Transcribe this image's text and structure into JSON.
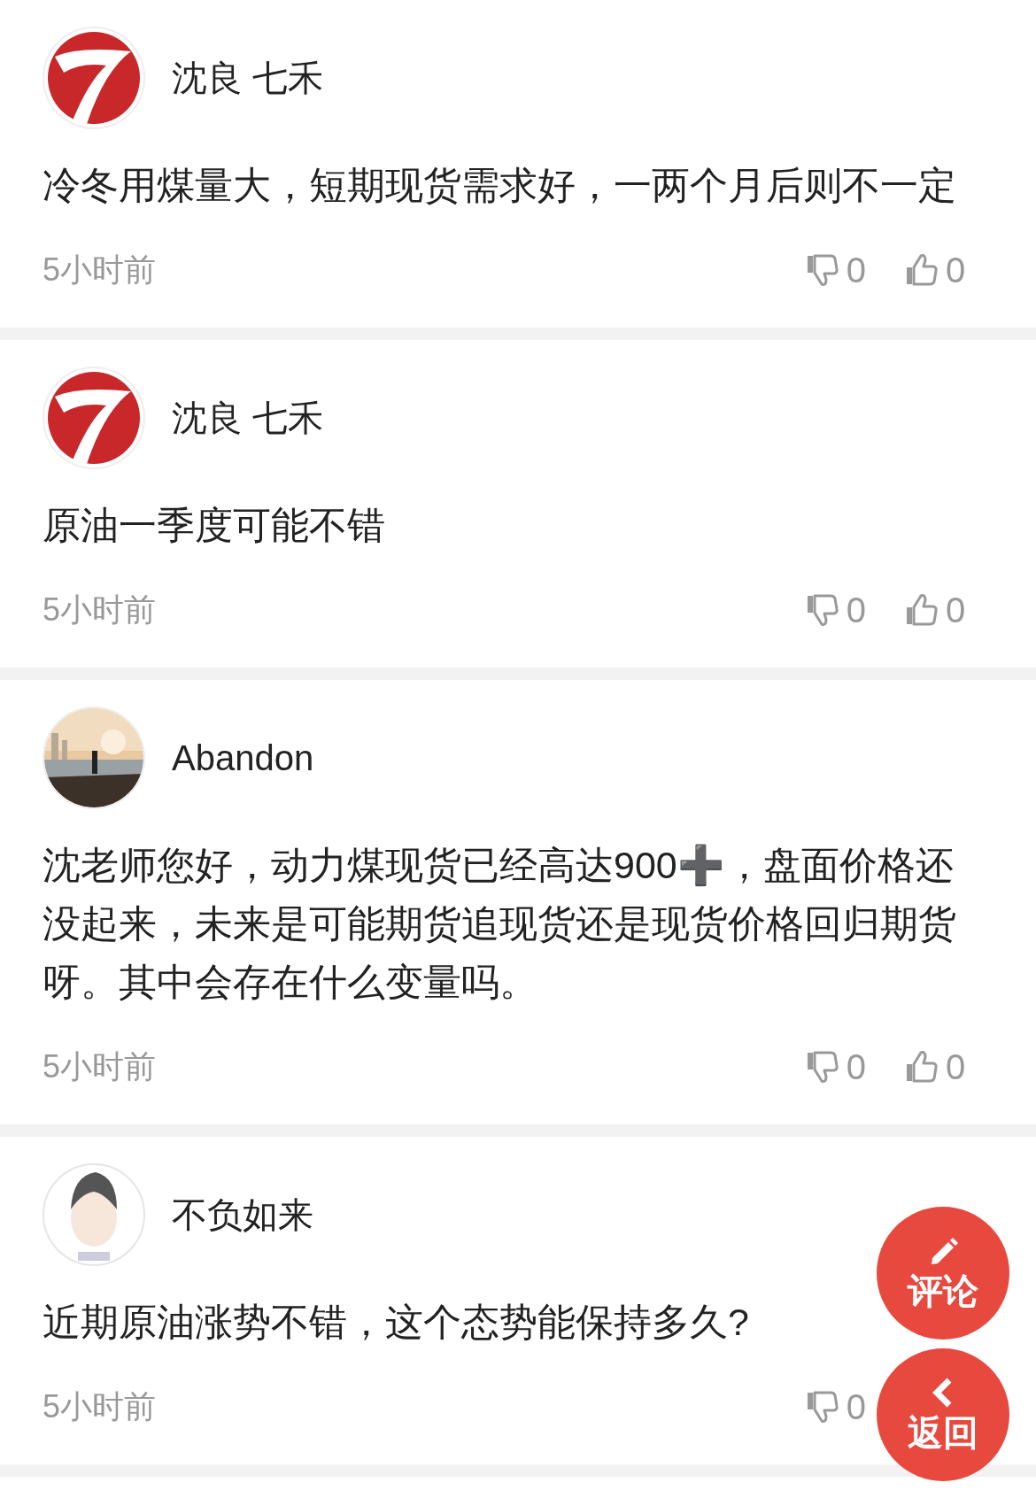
{
  "comments": [
    {
      "avatar": {
        "kind": "logo"
      },
      "name": "沈良 七禾",
      "text": "冷冬用煤量大，短期现货需求好，一两个月后则不一定",
      "time": "5小时前",
      "dislikes": "0",
      "likes": "0"
    },
    {
      "avatar": {
        "kind": "logo"
      },
      "name": "沈良 七禾",
      "text": "原油一季度可能不错",
      "time": "5小时前",
      "dislikes": "0",
      "likes": "0"
    },
    {
      "name": "Abandon",
      "text": "沈老师您好，动力煤现货已经高达900➕，盘面价格还没起来，未来是可能期货追现货还是现货价格回归期货呀。其中会存在什么变量吗。",
      "time": "5小时前",
      "dislikes": "0",
      "likes": "0"
    },
    {
      "avatar": {
        "kind": "figure"
      },
      "name": "不负如来",
      "text": "近期原油涨势不错，这个态势能保持多久?",
      "time": "5小时前",
      "dislikes": "0"
    }
  ],
  "floating_buttons": [
    {
      "kind": "comment",
      "label": "评论"
    },
    {
      "kind": "back",
      "label": "返回"
    }
  ]
}
